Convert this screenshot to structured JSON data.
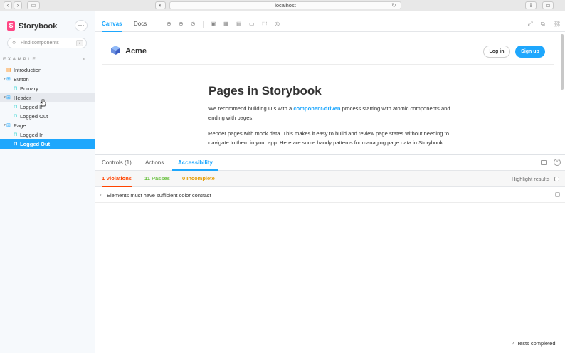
{
  "browser": {
    "url": "localhost",
    "back": "‹",
    "forward": "›",
    "sidebar_toggle": "▭",
    "reader": "◐",
    "reload": "↻",
    "share": "⇪",
    "tabs": "⧉"
  },
  "sidebar": {
    "brand": "Storybook",
    "brand_mark": "S",
    "menu": "···",
    "search_placeholder": "Find components",
    "search_shortcut": "/",
    "group": "EXAMPLE",
    "group_close": "x",
    "items": [
      {
        "label": "Introduction",
        "kind": "doc",
        "icon": "▤"
      },
      {
        "label": "Button",
        "kind": "component",
        "icon": "⊞"
      },
      {
        "label": "Primary",
        "kind": "story",
        "icon": "⊓"
      },
      {
        "label": "Header",
        "kind": "component",
        "icon": "⊞"
      },
      {
        "label": "Logged In",
        "kind": "story",
        "icon": "⊓"
      },
      {
        "label": "Logged Out",
        "kind": "story",
        "icon": "⊓"
      },
      {
        "label": "Page",
        "kind": "component",
        "icon": "⊞"
      },
      {
        "label": "Logged In",
        "kind": "story",
        "icon": "⊓"
      },
      {
        "label": "Logged Out",
        "kind": "story",
        "icon": "⊓"
      }
    ]
  },
  "toolbar": {
    "tabs": [
      "Canvas",
      "Docs"
    ]
  },
  "preview": {
    "company": "Acme",
    "login": "Log in",
    "signup": "Sign up",
    "title": "Pages in Storybook",
    "p1_pre": "We recommend building UIs with a ",
    "p1_link": "component-driven",
    "p1_post": " process starting with atomic components and ending with pages.",
    "p2": "Render pages with mock data. This makes it easy to build and review page states without needing to navigate to them in your app. Here are some handy patterns for managing page data in Storybook:"
  },
  "addons": {
    "tabs": [
      "Controls (1)",
      "Actions",
      "Accessibility"
    ],
    "violations": "1 Violations",
    "passes": "11 Passes",
    "incomplete": "0 Incomplete",
    "highlight": "Highlight results",
    "violation_item": "Elements must have sufficient color contrast",
    "status": "Tests completed"
  },
  "colors": {
    "accent": "#1ea7fd",
    "brand": "#ff4785",
    "violation": "#ff4400",
    "pass": "#66bf3c",
    "incomplete": "#e69d00"
  }
}
